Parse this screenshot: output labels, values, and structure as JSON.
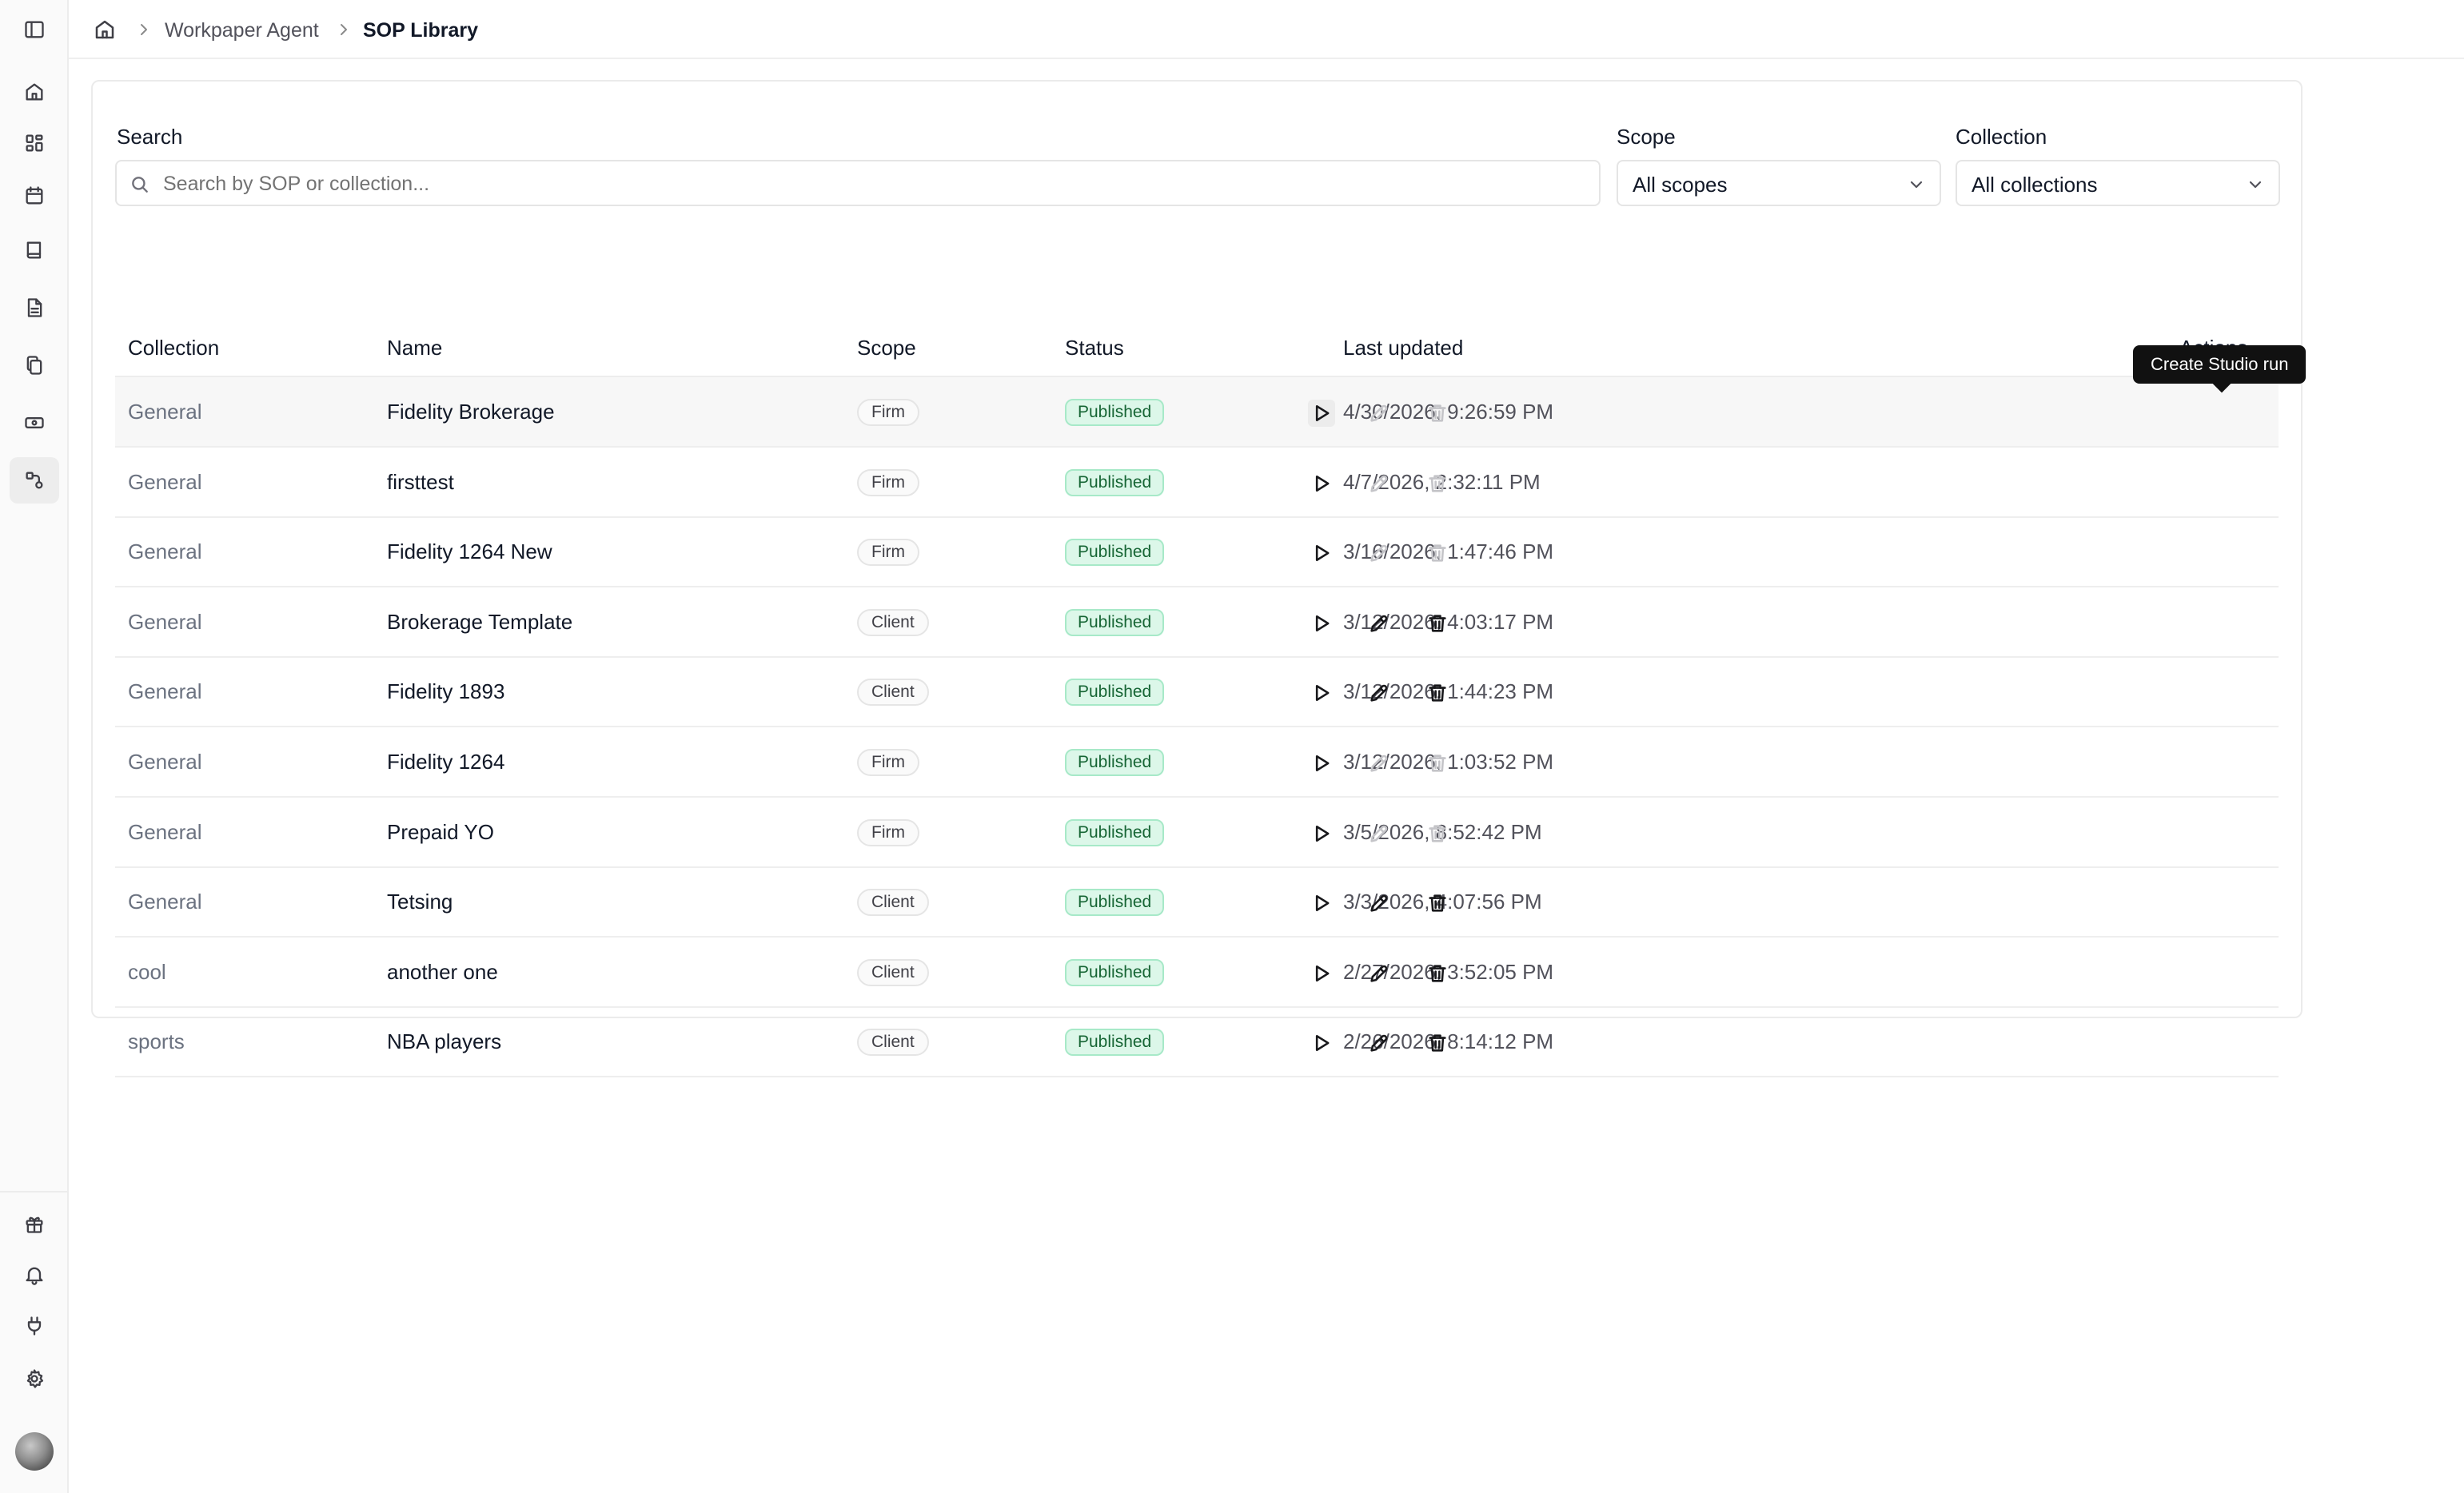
{
  "breadcrumb": {
    "home_icon": "home-icon",
    "items": [
      "Workpaper Agent",
      "SOP Library"
    ]
  },
  "sidebar": {
    "top_icons": [
      "sidebar-toggle-icon",
      "home-icon",
      "dashboard-icon",
      "calendar-icon",
      "book-icon",
      "document-icon",
      "copy-icon",
      "money-icon",
      "workflow-icon"
    ],
    "active_item": "workflow-icon",
    "bottom_icons": [
      "gift-icon",
      "bell-icon",
      "plug-icon",
      "gear-icon",
      "avatar"
    ]
  },
  "filters": {
    "search_label": "Search",
    "search_placeholder": "Search by SOP or collection...",
    "scope_label": "Scope",
    "scope_value": "All scopes",
    "collection_label": "Collection",
    "collection_value": "All collections"
  },
  "table": {
    "headers": {
      "collection": "Collection",
      "name": "Name",
      "scope": "Scope",
      "status": "Status",
      "last_updated": "Last updated",
      "actions": "Actions"
    },
    "rows": [
      {
        "collection": "General",
        "name": "Fidelity Brokerage",
        "scope": "Firm",
        "status": "Published",
        "last_updated": "4/30/2026, 9:26:59 PM",
        "editable": false
      },
      {
        "collection": "General",
        "name": "firsttest",
        "scope": "Firm",
        "status": "Published",
        "last_updated": "4/7/2026, 2:32:11 PM",
        "editable": false
      },
      {
        "collection": "General",
        "name": "Fidelity 1264 New",
        "scope": "Firm",
        "status": "Published",
        "last_updated": "3/16/2026, 1:47:46 PM",
        "editable": false
      },
      {
        "collection": "General",
        "name": "Brokerage Template",
        "scope": "Client",
        "status": "Published",
        "last_updated": "3/12/2026, 4:03:17 PM",
        "editable": true
      },
      {
        "collection": "General",
        "name": "Fidelity 1893",
        "scope": "Client",
        "status": "Published",
        "last_updated": "3/12/2026, 1:44:23 PM",
        "editable": true
      },
      {
        "collection": "General",
        "name": "Fidelity 1264",
        "scope": "Firm",
        "status": "Published",
        "last_updated": "3/12/2026, 1:03:52 PM",
        "editable": false
      },
      {
        "collection": "General",
        "name": "Prepaid YO",
        "scope": "Firm",
        "status": "Published",
        "last_updated": "3/5/2026, 8:52:42 PM",
        "editable": false
      },
      {
        "collection": "General",
        "name": "Tetsing",
        "scope": "Client",
        "status": "Published",
        "last_updated": "3/3/2026, 4:07:56 PM",
        "editable": true
      },
      {
        "collection": "cool",
        "name": "another one",
        "scope": "Client",
        "status": "Published",
        "last_updated": "2/27/2026, 3:52:05 PM",
        "editable": true
      },
      {
        "collection": "sports",
        "name": "NBA players",
        "scope": "Client",
        "status": "Published",
        "last_updated": "2/26/2026, 8:14:12 PM",
        "editable": true
      }
    ]
  },
  "tooltip": {
    "text": "Create Studio run"
  },
  "colors": {
    "status_published_bg": "#dcf7e9",
    "status_published_text": "#166534",
    "action_enabled": "#18181b",
    "action_disabled": "#c4c4c8"
  }
}
